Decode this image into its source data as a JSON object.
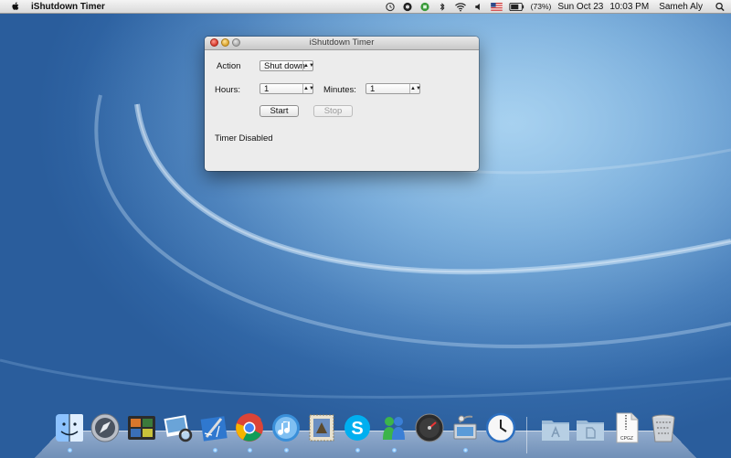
{
  "menubar": {
    "app_name": "iShutdown Timer",
    "battery_pct": "(73%)",
    "date": "Sun Oct 23",
    "time": "10:03 PM",
    "user": "Sameh Aly",
    "icons": [
      "clock-icon",
      "record-icon",
      "evernote-icon",
      "bluetooth-icon",
      "wifi-icon",
      "volume-icon",
      "us-flag-icon",
      "battery-icon",
      "spotlight-search-icon"
    ]
  },
  "window": {
    "title": "iShutdown Timer",
    "action_label": "Action",
    "action_value": "Shut down",
    "hours_label": "Hours:",
    "hours_value": "1",
    "minutes_label": "Minutes:",
    "minutes_value": "1",
    "start_label": "Start",
    "stop_label": "Stop",
    "status_text": "Timer Disabled",
    "popup_arrow": "▲▼"
  },
  "dock": {
    "items": [
      "finder-icon",
      "launchpad-icon",
      "photo-booth-icon",
      "iphoto-icon",
      "xcode-icon",
      "chrome-icon",
      "itunes-icon",
      "mail-stamp-icon",
      "skype-icon",
      "messenger-icon",
      "dashboard-icon",
      "network-utility-icon",
      "clock-app-icon",
      "applications-folder-icon",
      "documents-folder-icon",
      "cpgz-file-icon",
      "trash-icon"
    ],
    "file_label": "CPGZ"
  },
  "colors": {
    "menubar_bg": "#e6e6e6",
    "desktop_blue": "#3a73b3",
    "window_bg": "#ececec",
    "close_red": "#e0443a",
    "min_yellow": "#e6b031"
  }
}
